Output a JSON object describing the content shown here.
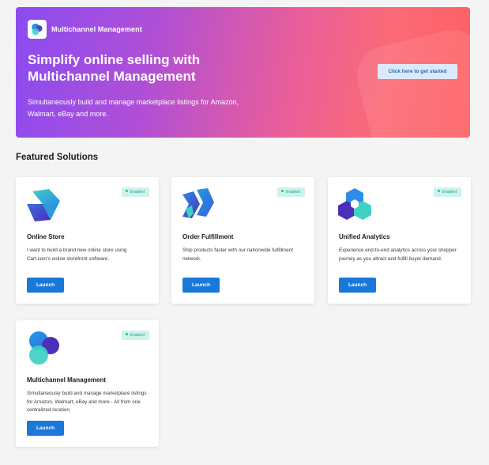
{
  "hero": {
    "brand_name": "Multichannel Management",
    "title": "Simplify online selling with Multichannel Management",
    "subtitle": "Simultaneously build and manage marketplace listings for Amazon, Walmart, eBay and more.",
    "cta_label": "Click here to get started"
  },
  "featured": {
    "title": "Featured Solutions",
    "cards": [
      {
        "icon": "online-store-icon",
        "status": "Enabled",
        "title": "Online Store",
        "description": "I want to build a brand new online store using Cart.com's online storefront software.",
        "button": "Launch"
      },
      {
        "icon": "order-fulfillment-icon",
        "status": "Enabled",
        "title": "Order Fulfillment",
        "description": "Ship products faster with our nationwide fulfillment network.",
        "button": "Launch"
      },
      {
        "icon": "unified-analytics-icon",
        "status": "Enabled",
        "title": "Unified Analytics",
        "description": "Experience end-to-end analytics across your shopper journey as you attract and fulfill buyer demand.",
        "button": "Launch"
      },
      {
        "icon": "multichannel-management-icon",
        "status": "Enabled",
        "title": "Multichannel Management",
        "description": "Simultaneously build and manage marketplace listings for Amazon, Walmart, eBay and more - All from one centralized location.",
        "button": "Launch"
      }
    ]
  },
  "colors": {
    "hero_gradient_start": "#8b4bf0",
    "hero_gradient_end": "#ff5e62",
    "primary_button": "#1a78d8",
    "badge_bg": "#cdf3ec",
    "badge_text": "#2c9f88"
  }
}
